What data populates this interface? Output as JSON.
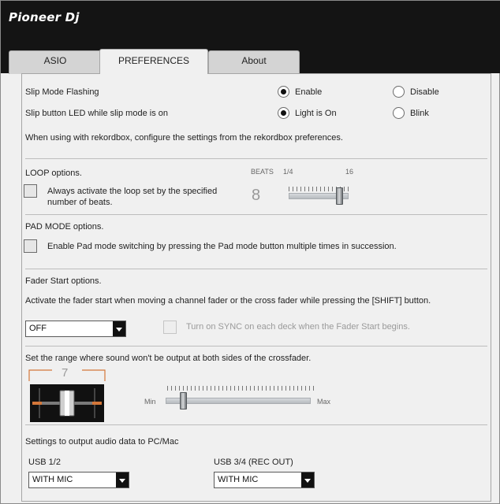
{
  "brand": {
    "logo_text": "Pioneer Dj"
  },
  "tabs": [
    {
      "label": "ASIO",
      "active": false
    },
    {
      "label": "PREFERENCES",
      "active": true
    },
    {
      "label": "About",
      "active": false
    }
  ],
  "slip": {
    "flash_label": "Slip Mode Flashing",
    "flash_enable": "Enable",
    "flash_disable": "Disable",
    "flash_selected": "Enable",
    "led_label": "Slip button LED while slip mode is on",
    "led_light": "Light is On",
    "led_blink": "Blink",
    "led_selected": "Light is On",
    "rekordbox_note": "When using with rekordbox, configure the settings from the rekordbox preferences."
  },
  "loop": {
    "title": "LOOP options.",
    "checkbox_label_line1": "Always activate the loop set by the specified",
    "checkbox_label_line2": "number of beats.",
    "checked": false,
    "beats_label": "BEATS",
    "beats_min": "1/4",
    "beats_max": "16",
    "beats_value": "8"
  },
  "pad": {
    "title": "PAD MODE options.",
    "checkbox_label": "Enable Pad mode switching by pressing the Pad mode button multiple times in succession.",
    "checked": false
  },
  "fader": {
    "title": "Fader Start options.",
    "description": "Activate the fader start when moving a channel fader or the cross fader while pressing the [SHIFT] button.",
    "select_value": "OFF",
    "sync_label": "Turn on SYNC on each deck when the Fader Start begins.",
    "sync_checked": false
  },
  "crossfader": {
    "description": "Set the range where sound won't be output at both sides of the crossfader.",
    "value": "7",
    "min_label": "Min",
    "max_label": "Max",
    "level_fraction": 0.1
  },
  "audio_output": {
    "title": "Settings to output audio data to PC/Mac",
    "usb12_label": "USB 1/2",
    "usb12_value": "WITH MIC",
    "usb34_label": "USB 3/4 (REC OUT)",
    "usb34_value": "WITH MIC"
  },
  "colors": {
    "titlebar": "#141414",
    "crossfader_accent": "#d4773a"
  },
  "icons": [
    "dropdown-arrow-icon",
    "crossfader-icon"
  ]
}
